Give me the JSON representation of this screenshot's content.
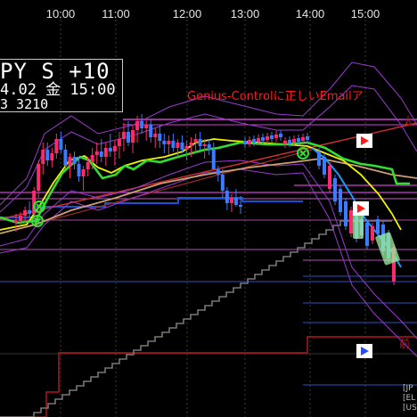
{
  "header": {
    "symbol_line": "PY S +10",
    "date_line": "4.02 金 15:00",
    "ohlc_line": "3 3210"
  },
  "annotation": {
    "text": "Genius-Controlに正しいEmailア"
  },
  "side_labels": {
    "right_top": "太",
    "prev_high": "前"
  },
  "corner_labels": [
    "[JP",
    "[EL",
    "[US"
  ],
  "chart_data": {
    "type": "candlestick",
    "x_tick_labels": [
      "10:00",
      "11:00",
      "12:00",
      "13:00",
      "14:00",
      "15:00"
    ],
    "colors": {
      "up": "#ff2a6d",
      "down": "#3a7bff",
      "ma_yellow": "#f2f200",
      "ma_green": "#33dd33",
      "ma_tan": "#caa070",
      "bollinger": "#9a3bd0",
      "support_line": "#1e4fd8",
      "step_line": "#777777",
      "prev_high_line": "#b01818",
      "trend_line": "#d03030",
      "magenta_level": "#d040d0",
      "blue_level": "#3050c0"
    },
    "candles": [
      [
        250,
        260,
        240,
        248
      ],
      [
        248,
        252,
        238,
        242
      ],
      [
        242,
        250,
        232,
        236
      ],
      [
        236,
        244,
        226,
        240
      ],
      [
        240,
        246,
        210,
        214
      ],
      [
        214,
        222,
        180,
        184
      ],
      [
        184,
        196,
        160,
        168
      ],
      [
        168,
        186,
        160,
        180
      ],
      [
        180,
        188,
        166,
        172
      ],
      [
        172,
        178,
        150,
        156
      ],
      [
        156,
        172,
        148,
        168
      ],
      [
        168,
        190,
        162,
        186
      ],
      [
        186,
        200,
        172,
        176
      ],
      [
        176,
        190,
        170,
        184
      ],
      [
        184,
        204,
        176,
        198
      ],
      [
        198,
        214,
        186,
        190
      ],
      [
        190,
        198,
        176,
        182
      ],
      [
        182,
        190,
        166,
        174
      ],
      [
        174,
        184,
        160,
        170
      ],
      [
        170,
        182,
        156,
        176
      ],
      [
        176,
        186,
        160,
        166
      ],
      [
        166,
        176,
        150,
        170
      ],
      [
        170,
        186,
        158,
        164
      ],
      [
        164,
        178,
        148,
        156
      ],
      [
        156,
        170,
        138,
        148
      ],
      [
        148,
        164,
        136,
        160
      ],
      [
        160,
        172,
        140,
        146
      ],
      [
        146,
        160,
        130,
        136
      ],
      [
        136,
        150,
        128,
        144
      ],
      [
        144,
        158,
        134,
        140
      ],
      [
        140,
        160,
        134,
        154
      ],
      [
        154,
        166,
        144,
        150
      ],
      [
        150,
        166,
        140,
        158
      ],
      [
        158,
        172,
        150,
        162
      ],
      [
        162,
        174,
        152,
        158
      ],
      [
        158,
        170,
        150,
        166
      ],
      [
        166,
        176,
        156,
        160
      ],
      [
        160,
        172,
        152,
        168
      ],
      [
        168,
        180,
        158,
        164
      ],
      [
        164,
        176,
        154,
        160
      ],
      [
        160,
        172,
        150,
        156
      ],
      [
        156,
        168,
        148,
        164
      ],
      [
        164,
        178,
        156,
        162
      ],
      [
        162,
        174,
        156,
        168
      ],
      [
        168,
        184,
        160,
        190
      ],
      [
        190,
        204,
        186,
        196
      ],
      [
        196,
        222,
        190,
        214
      ],
      [
        214,
        236,
        210,
        228
      ],
      [
        228,
        238,
        218,
        222
      ],
      [
        222,
        232,
        212,
        230
      ],
      [
        230,
        240,
        220,
        232
      ]
    ],
    "price_range": [
      0,
      468
    ]
  }
}
